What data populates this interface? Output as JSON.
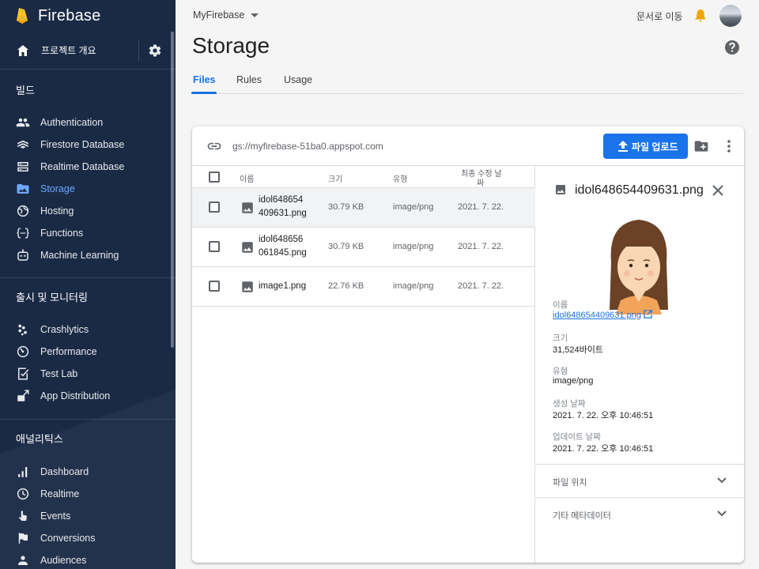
{
  "sidebar": {
    "brand": "Firebase",
    "overview_label": "프로젝트 개요",
    "sections": [
      {
        "title": "빌드",
        "items": [
          {
            "label": "Authentication",
            "icon": "people-icon"
          },
          {
            "label": "Firestore Database",
            "icon": "firestore-icon"
          },
          {
            "label": "Realtime Database",
            "icon": "database-icon"
          },
          {
            "label": "Storage",
            "icon": "image-folder-icon",
            "active": true
          },
          {
            "label": "Hosting",
            "icon": "globe-icon"
          },
          {
            "label": "Functions",
            "icon": "functions-icon"
          },
          {
            "label": "Machine Learning",
            "icon": "robot-icon"
          }
        ]
      },
      {
        "title": "출시 및 모니터링",
        "items": [
          {
            "label": "Crashlytics",
            "icon": "crashlytics-icon"
          },
          {
            "label": "Performance",
            "icon": "speedometer-icon"
          },
          {
            "label": "Test Lab",
            "icon": "checklist-icon"
          },
          {
            "label": "App Distribution",
            "icon": "app-distribution-icon"
          }
        ]
      },
      {
        "title": "애널리틱스",
        "items": [
          {
            "label": "Dashboard",
            "icon": "bar-chart-icon"
          },
          {
            "label": "Realtime",
            "icon": "clock-icon"
          },
          {
            "label": "Events",
            "icon": "touch-icon"
          },
          {
            "label": "Conversions",
            "icon": "flag-icon"
          },
          {
            "label": "Audiences",
            "icon": "audience-icon"
          }
        ]
      }
    ]
  },
  "header": {
    "project": "MyFirebase",
    "docs_link": "문서로 이동",
    "title": "Storage",
    "tabs": [
      "Files",
      "Rules",
      "Usage"
    ],
    "active_tab": "Files"
  },
  "storage": {
    "bucket": "gs://myfirebase-51ba0.appspot.com",
    "upload_label": "파일 업로드",
    "columns": {
      "name": "이름",
      "size": "크기",
      "type": "유형",
      "modified_line1": "최종 수정 날",
      "modified_line2": "짜"
    },
    "files": [
      {
        "name_line1": "idol648654",
        "name_line2": "409631.png",
        "size": "30.79 KB",
        "type": "image/png",
        "modified": "2021. 7. 22.",
        "selected": true
      },
      {
        "name_line1": "idol648656",
        "name_line2": "061845.png",
        "size": "30.79 KB",
        "type": "image/png",
        "modified": "2021. 7. 22.",
        "selected": false
      },
      {
        "name_line1": "image1.png",
        "name_line2": "",
        "size": "22.76 KB",
        "type": "image/png",
        "modified": "2021. 7. 22.",
        "selected": false
      }
    ]
  },
  "detail": {
    "title": "idol648654409631.png",
    "name_label": "이름",
    "name_value": "idol648654409631.png",
    "size_label": "크기",
    "size_value": "31,524바이트",
    "type_label": "유형",
    "type_value": "image/png",
    "created_label": "생성 날짜",
    "created_value": "2021. 7. 22. 오후 10:46:51",
    "updated_label": "업데이트 날짜",
    "updated_value": "2021. 7. 22. 오후 10:46:51",
    "accordions": [
      "파일 위치",
      "기타 메타데이터"
    ]
  },
  "colors": {
    "sidebar_bg": "#1a2a45",
    "accent": "#1a73e8",
    "active_nav": "#6fa8ff"
  }
}
